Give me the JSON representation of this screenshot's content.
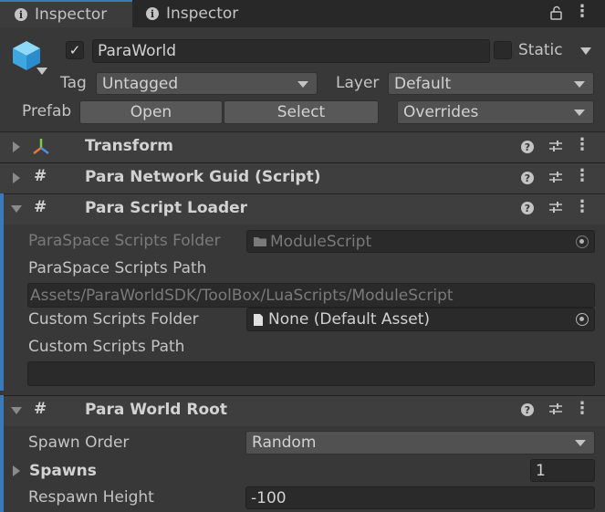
{
  "tabs": [
    {
      "label": "Inspector"
    },
    {
      "label": "Inspector"
    }
  ],
  "header": {
    "object_name": "ParaWorld",
    "static_label": "Static",
    "tag_label": "Tag",
    "tag_value": "Untagged",
    "layer_label": "Layer",
    "layer_value": "Default",
    "prefab_label": "Prefab",
    "open_label": "Open",
    "select_label": "Select",
    "overrides_label": "Overrides"
  },
  "components": {
    "transform": {
      "title": "Transform"
    },
    "guid": {
      "title": "Para Network Guid (Script)"
    },
    "loader": {
      "title": "Para Script Loader",
      "folder_label": "ParaSpace Scripts Folder",
      "folder_value": "ModuleScript",
      "path_label": "ParaSpace Scripts Path",
      "path_value": "Assets/ParaWorldSDK/ToolBox/LuaScripts/ModuleScript",
      "custom_folder_label": "Custom Scripts Folder",
      "custom_folder_value": "None (Default Asset)",
      "custom_path_label": "Custom Scripts Path",
      "custom_path_value": ""
    },
    "root": {
      "title": "Para World Root",
      "spawn_order_label": "Spawn Order",
      "spawn_order_value": "Random",
      "spawns_label": "Spawns",
      "spawns_count": "1",
      "respawn_label": "Respawn Height",
      "respawn_value": "-100"
    }
  },
  "colors": {
    "accent": "#3a79bb",
    "background": "#383838",
    "header_background": "#3e3e3e",
    "field_background": "#2a2a2a"
  }
}
